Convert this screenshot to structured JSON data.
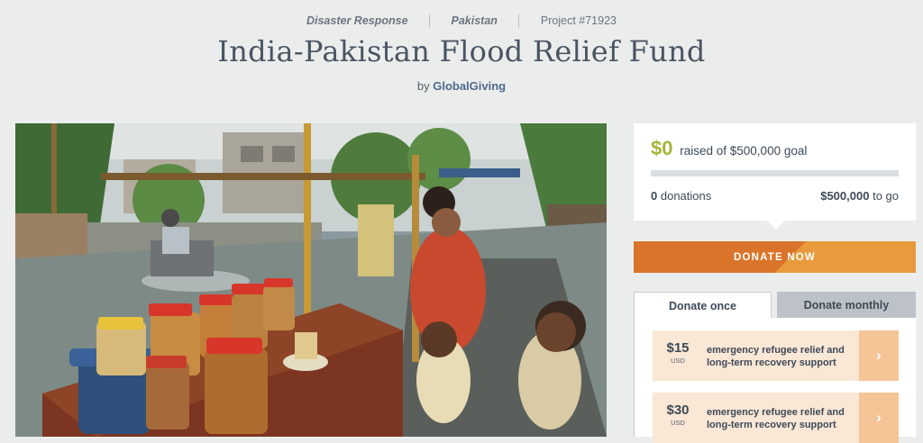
{
  "breadcrumb": {
    "category": "Disaster Response",
    "country": "Pakistan",
    "project": "Project #71923"
  },
  "title": "India-Pakistan Flood Relief Fund",
  "byline": {
    "prefix": "by",
    "org": "GlobalGiving"
  },
  "photo": {
    "alt": "Flooded street with a roadside snack stall, a woman and two children watching a motorcyclist ride through water"
  },
  "funding": {
    "raised": "$0",
    "raised_text": "raised of $500,000 goal",
    "progress": 0,
    "donations_count": "0",
    "donations_label": "donations",
    "to_go_amount": "$500,000",
    "to_go_label": "to go"
  },
  "donate_now_label": "DONATE NOW",
  "tabs": [
    {
      "label": "Donate once",
      "active": true
    },
    {
      "label": "Donate monthly",
      "active": false
    }
  ],
  "options": [
    {
      "amount": "$15",
      "currency": "USD",
      "description": "emergency refugee relief and long-term recovery support",
      "arrow": "›"
    },
    {
      "amount": "$30",
      "currency": "USD",
      "description": "emergency refugee relief and long-term recovery support",
      "arrow": "›"
    }
  ],
  "colors": {
    "background": "#ebeded",
    "accent_green": "#a7b33a",
    "donate_orange": "#d9742a",
    "option_bg": "#fbe7d6",
    "option_arrow": "#f5c497"
  }
}
